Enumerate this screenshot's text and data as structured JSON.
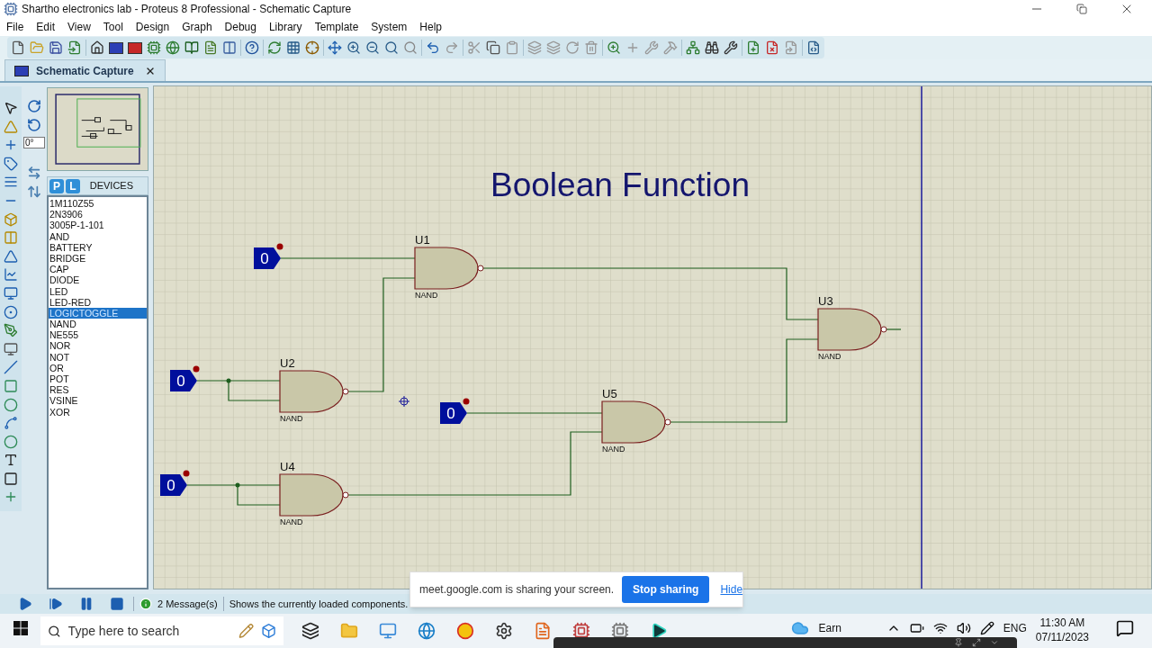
{
  "window": {
    "title": "Shartho electronics lab - Proteus 8 Professional - Schematic Capture"
  },
  "menu": [
    "File",
    "Edit",
    "View",
    "Tool",
    "Design",
    "Graph",
    "Debug",
    "Library",
    "Template",
    "System",
    "Help"
  ],
  "tabs": [
    {
      "label": "Schematic Capture",
      "selected": true
    }
  ],
  "rotation": {
    "value": "0°"
  },
  "library": {
    "buttons": [
      "P",
      "L"
    ],
    "title": "DEVICES",
    "items": [
      {
        "label": "1M110Z55",
        "selected": false
      },
      {
        "label": "2N3906",
        "selected": false
      },
      {
        "label": "3005P-1-101",
        "selected": false
      },
      {
        "label": "AND",
        "selected": false
      },
      {
        "label": "BATTERY",
        "selected": false
      },
      {
        "label": "BRIDGE",
        "selected": false
      },
      {
        "label": "CAP",
        "selected": false
      },
      {
        "label": "DIODE",
        "selected": false
      },
      {
        "label": "LED",
        "selected": false
      },
      {
        "label": "LED-RED",
        "selected": false
      },
      {
        "label": "LOGICTOGGLE",
        "selected": true
      },
      {
        "label": "NAND",
        "selected": false
      },
      {
        "label": "NE555",
        "selected": false
      },
      {
        "label": "NOR",
        "selected": false
      },
      {
        "label": "NOT",
        "selected": false
      },
      {
        "label": "OR",
        "selected": false
      },
      {
        "label": "POT",
        "selected": false
      },
      {
        "label": "RES",
        "selected": false
      },
      {
        "label": "VSINE",
        "selected": false
      },
      {
        "label": "XOR",
        "selected": false
      }
    ]
  },
  "schematic": {
    "title": "Boolean Function",
    "gates": [
      {
        "ref": "U1",
        "type": "NAND"
      },
      {
        "ref": "U2",
        "type": "NAND"
      },
      {
        "ref": "U4",
        "type": "NAND"
      },
      {
        "ref": "U5",
        "type": "NAND"
      },
      {
        "ref": "U3",
        "type": "NAND"
      }
    ],
    "toggles": [
      {
        "value": "0"
      },
      {
        "value": "0"
      },
      {
        "value": "0"
      },
      {
        "value": "0"
      }
    ]
  },
  "status_bar": {
    "messages": "2 Message(s)",
    "hint": "Shows the currently loaded components."
  },
  "share_banner": {
    "text": "meet.google.com is sharing your screen.",
    "button": "Stop sharing",
    "link": "Hide"
  },
  "taskbar": {
    "search": {
      "placeholder": "Type here to search"
    },
    "weather": "Earn",
    "language": "ENG",
    "time": "11:30 AM",
    "date": "07/11/2023"
  }
}
